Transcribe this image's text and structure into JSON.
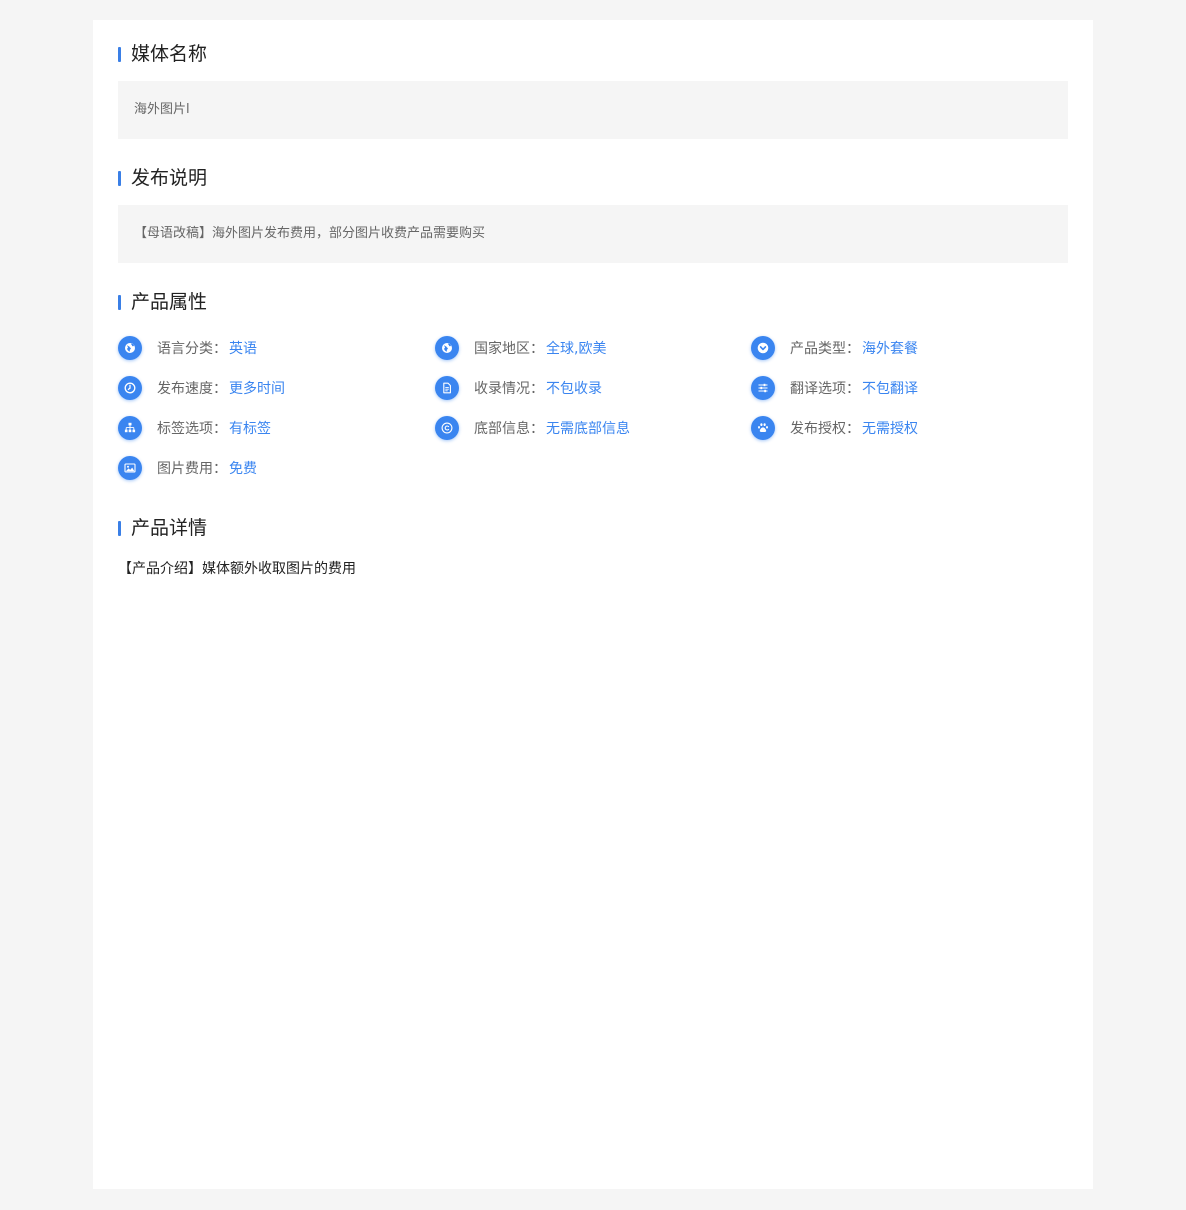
{
  "media_name": {
    "title": "媒体名称",
    "value": "海外图片l"
  },
  "publish_note": {
    "title": "发布说明",
    "value": "【母语改稿】海外图片发布费用，部分图片收费产品需要购买"
  },
  "attributes": {
    "title": "产品属性",
    "items": [
      {
        "label": "语言分类：",
        "value": "英语",
        "icon": "globe-icon"
      },
      {
        "label": "国家地区：",
        "value": "全球,欧美",
        "icon": "globe-icon"
      },
      {
        "label": "产品类型：",
        "value": "海外套餐",
        "icon": "chevron-down-icon"
      },
      {
        "label": "发布速度：",
        "value": "更多时间",
        "icon": "clock-icon"
      },
      {
        "label": "收录情况：",
        "value": "不包收录",
        "icon": "document-icon"
      },
      {
        "label": "翻译选项：",
        "value": "不包翻译",
        "icon": "sliders-icon"
      },
      {
        "label": "标签选项：",
        "value": "有标签",
        "icon": "sitemap-icon"
      },
      {
        "label": "底部信息：",
        "value": "无需底部信息",
        "icon": "copyright-icon"
      },
      {
        "label": "发布授权：",
        "value": "无需授权",
        "icon": "paw-icon"
      },
      {
        "label": "图片费用：",
        "value": "免费",
        "icon": "image-icon"
      }
    ]
  },
  "details": {
    "title": "产品详情",
    "value": "【产品介绍】媒体额外收取图片的费用"
  }
}
